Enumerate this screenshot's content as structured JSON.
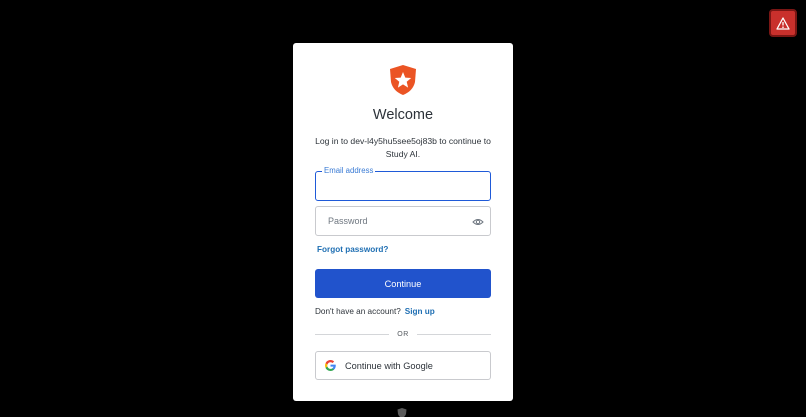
{
  "alert": {
    "icon": "warning-triangle-icon"
  },
  "login": {
    "logo_icon": "auth0-shield-logo",
    "title": "Welcome",
    "subtitle": "Log in to dev-l4y5hu5see5oj83b to continue to Study AI.",
    "email": {
      "label": "Email address",
      "value": ""
    },
    "password": {
      "placeholder": "Password",
      "value": "",
      "toggle_icon": "eye-icon"
    },
    "forgot_password": "Forgot password?",
    "continue_label": "Continue",
    "signup_prompt": "Don't have an account?",
    "signup_link": "Sign up",
    "divider_text": "OR",
    "google_label": "Continue with Google"
  },
  "colors": {
    "background": "#000000",
    "primary": "#2153cc",
    "link": "#1f6fb3",
    "logo": "#eb5424",
    "alert": "#c9302c"
  }
}
